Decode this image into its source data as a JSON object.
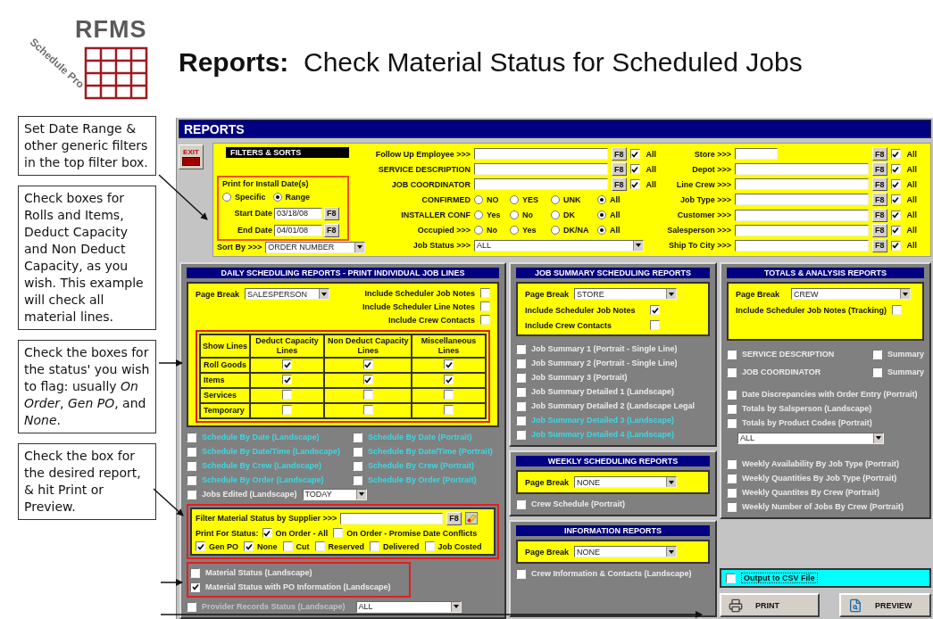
{
  "header": {
    "logo_name": "RFMS",
    "logo_tagline": "Schedule Pro",
    "title": "**Reports:**  Check Material Status for Scheduled Jobs"
  },
  "callouts": [
    {
      "text": "Set Date Range & other generic filters in the top filter box."
    },
    {
      "text": "Check boxes for Rolls and Items, Deduct Capacity and Non Deduct Capacity, as you wish.  This example will check all material lines."
    },
    {
      "text": "Check the boxes for the status' you wish to flag: usually *On Order*, *Gen PO*, and *None*."
    },
    {
      "text": "Check the box for the desired report, & hit Print or Preview."
    }
  ],
  "window": {
    "title": "REPORTS",
    "exit_label": "EXIT"
  },
  "filters": {
    "heading": "FILTERS & SORTS",
    "install_dates": {
      "title": "Print for Install Date(s)",
      "modes": [
        {
          "label": "Specific",
          "selected": false
        },
        {
          "label": "Range",
          "selected": true
        }
      ],
      "dates": [
        {
          "label": "Start Date",
          "value": "03/18/08",
          "button": "F8"
        },
        {
          "label": "End Date",
          "value": "04/01/08",
          "button": "F8"
        }
      ]
    },
    "sort": {
      "label": "Sort By >>>",
      "value": "ORDER NUMBER"
    },
    "left_filters": [
      {
        "kind": "text",
        "label": "Follow Up Employee >>>",
        "button": "F8",
        "all": {
          "label": "All",
          "checked": true
        }
      },
      {
        "kind": "text",
        "label": "SERVICE DESCRIPTION",
        "button": "F8",
        "all": {
          "label": "All",
          "checked": true
        }
      },
      {
        "kind": "text",
        "label": "JOB COORDINATOR",
        "button": "F8",
        "all": {
          "label": "All",
          "checked": true
        }
      },
      {
        "kind": "radio",
        "label": "CONFIRMED",
        "options": [
          {
            "label": "NO",
            "selected": false
          },
          {
            "label": "YES",
            "selected": false
          },
          {
            "label": "UNK",
            "selected": false
          },
          {
            "label": "All",
            "selected": true
          }
        ]
      },
      {
        "kind": "radio",
        "label": "INSTALLER CONF",
        "options": [
          {
            "label": "Yes",
            "selected": false
          },
          {
            "label": "No",
            "selected": false
          },
          {
            "label": "DK",
            "selected": false
          },
          {
            "label": "All",
            "selected": true
          }
        ]
      },
      {
        "kind": "radio",
        "label": "Occupied >>>",
        "options": [
          {
            "label": "No",
            "selected": false
          },
          {
            "label": "Yes",
            "selected": false
          },
          {
            "label": "DK/NA",
            "selected": false
          },
          {
            "label": "All",
            "selected": true
          }
        ]
      },
      {
        "kind": "select",
        "label": "Job Status >>>",
        "value": "ALL"
      }
    ],
    "right_filters": [
      {
        "label": "Store >>>",
        "short": true,
        "button": "F8",
        "all": {
          "label": "All",
          "checked": true
        }
      },
      {
        "label": "Depot >>>",
        "short": false,
        "button": "F8",
        "all": {
          "label": "All",
          "checked": true
        }
      },
      {
        "label": "Line Crew >>>",
        "short": false,
        "button": "F8",
        "all": {
          "label": "All",
          "checked": true
        }
      },
      {
        "label": "Job Type >>>",
        "short": false,
        "button": "F8",
        "all": {
          "label": "All",
          "checked": true
        }
      },
      {
        "label": "Customer >>>",
        "short": false,
        "button": "F8",
        "all": {
          "label": "All",
          "checked": true
        }
      },
      {
        "label": "Salesperson >>>",
        "short": false,
        "button": "F8",
        "all": {
          "label": "All",
          "checked": true
        }
      },
      {
        "label": "Ship To City >>>",
        "short": false,
        "button": "F8",
        "all": {
          "label": "All",
          "checked": true
        }
      }
    ]
  },
  "daily": {
    "title": "DAILY SCHEDULING REPORTS - PRINT INDIVIDUAL JOB LINES",
    "page_break": {
      "label": "Page Break",
      "value": "SALESPERSON"
    },
    "options": [
      {
        "label": "Include Scheduler Job Notes",
        "checked": false
      },
      {
        "label": "Include Scheduler Line Notes",
        "checked": false
      },
      {
        "label": "Include Crew Contacts",
        "checked": false
      }
    ],
    "lines": {
      "columns": [
        "Show Lines",
        "Deduct Capacity Lines",
        "Non Deduct Capacity Lines",
        "Miscellaneous Lines"
      ],
      "rows": [
        {
          "label": "Roll Goods",
          "checked": [
            true,
            true,
            true
          ]
        },
        {
          "label": "Items",
          "checked": [
            true,
            true,
            true
          ]
        },
        {
          "label": "Services",
          "checked": [
            false,
            false,
            false
          ]
        },
        {
          "label": "Temporary",
          "checked": [
            false,
            false,
            false
          ]
        }
      ]
    },
    "reports": [
      {
        "label": "Schedule By Date (Landscape)",
        "checked": false,
        "kind": "highlighted"
      },
      {
        "label": "Schedule By Date (Portrait)",
        "checked": false,
        "kind": "highlighted"
      },
      {
        "label": "Schedule By Date/Time (Landscape)",
        "checked": false,
        "kind": "highlighted"
      },
      {
        "label": "Schedule By Date/Time (Portrait)",
        "checked": false,
        "kind": "highlighted"
      },
      {
        "label": "Schedule By Crew (Landscape)",
        "checked": false,
        "kind": "highlighted"
      },
      {
        "label": "Schedule By Crew (Portrait)",
        "checked": false,
        "kind": "highlighted"
      },
      {
        "label": "Schedule By Order (Landscape)",
        "checked": false,
        "kind": "highlighted"
      },
      {
        "label": "Schedule By Order (Portrait)",
        "checked": false,
        "kind": "highlighted"
      }
    ],
    "jobs_edited": {
      "label": "Jobs Edited (Landscape)",
      "checked": false,
      "kind": "plain",
      "value": "TODAY"
    },
    "material_filter": {
      "label": "Filter Material Status by Supplier >>>",
      "button": "F8",
      "status_label": "Print For Status:",
      "status_rows": [
        [
          {
            "label": "On Order - All",
            "checked": true
          },
          {
            "label": "On Order - Promise Date Conflicts",
            "checked": false
          }
        ],
        [
          {
            "label": "Gen PO",
            "checked": true
          },
          {
            "label": "None",
            "checked": true
          },
          {
            "label": "Cut",
            "checked": false
          },
          {
            "label": "Reserved",
            "checked": false
          },
          {
            "label": "Delivered",
            "checked": false
          },
          {
            "label": "Job Costed",
            "checked": false
          }
        ]
      ]
    },
    "material_reports": [
      {
        "label": "Material Status (Landscape)",
        "checked": false,
        "kind": "plain"
      },
      {
        "label": "Material Status with PO Information (Landscape)",
        "checked": true,
        "kind": "plain"
      }
    ],
    "provider": {
      "label": "Provider Records Status (Landscape)",
      "checked": false,
      "kind": "disabled",
      "value": "ALL"
    }
  },
  "job_summary": {
    "title": "JOB SUMMARY SCHEDULING REPORTS",
    "page_break": {
      "label": "Page Break",
      "value": "STORE"
    },
    "options": [
      {
        "label": "Include Scheduler Job Notes",
        "checked": true
      },
      {
        "label": "Include Crew Contacts",
        "checked": false
      }
    ],
    "reports": [
      {
        "label": "Job Summary 1 (Portrait - Single Line)",
        "checked": false,
        "kind": "plain"
      },
      {
        "label": "Job Summary 2 (Portrait - Single Line)",
        "checked": false,
        "kind": "plain"
      },
      {
        "label": "Job Summary 3 (Portrait)",
        "checked": false,
        "kind": "plain"
      },
      {
        "label": "Job Summary Detailed 1 (Landscape)",
        "checked": false,
        "kind": "plain"
      },
      {
        "label": "Job Summary Detailed 2 (Landscape Legal",
        "checked": false,
        "kind": "plain"
      },
      {
        "label": "Job Summary Detailed 3 (Landscape)",
        "checked": false,
        "kind": "highlighted"
      },
      {
        "label": "Job Summary Detailed 4 (Landscape)",
        "checked": false,
        "kind": "highlighted"
      }
    ]
  },
  "weekly": {
    "title": "WEEKLY SCHEDULING REPORTS",
    "page_break": {
      "label": "Page Break",
      "value": "NONE"
    },
    "reports": [
      {
        "label": "Crew Schedule (Portrait)",
        "checked": false,
        "kind": "plain"
      }
    ]
  },
  "information": {
    "title": "INFORMATION REPORTS",
    "page_break": {
      "label": "Page Break",
      "value": "NONE"
    },
    "reports": [
      {
        "label": "Crew Information & Contacts (Landscape)",
        "checked": false,
        "kind": "plain"
      }
    ]
  },
  "totals": {
    "title": "TOTALS & ANALYSIS REPORTS",
    "page_break": {
      "label": "Page Break",
      "value": "CREW"
    },
    "options": [
      {
        "label": "Include Scheduler Job Notes (Tracking)",
        "checked": false
      }
    ],
    "pairs": [
      {
        "label": "SERVICE DESCRIPTION",
        "checked": false,
        "summary": {
          "label": "Summary",
          "checked": false
        }
      },
      {
        "label": "JOB COORDINATOR",
        "checked": false,
        "summary": {
          "label": "Summary",
          "checked": false
        }
      }
    ],
    "reports": [
      {
        "label": "Date Discrepancies with Order Entry (Portrait)",
        "checked": false,
        "kind": "plain"
      },
      {
        "label": "Totals by Salsperson (Landscape)",
        "checked": false,
        "kind": "plain"
      },
      {
        "label": "Totals by Product Codes (Portrait)",
        "checked": false,
        "kind": "plain"
      }
    ],
    "product_codes": {
      "value": "ALL"
    },
    "weekly_reports": [
      {
        "label": "Weekly Availability By Job Type (Portrait)",
        "checked": false,
        "kind": "plain"
      },
      {
        "label": "Weekly Quantities By Job Type (Portrait)",
        "checked": false,
        "kind": "plain"
      },
      {
        "label": "Weekly Quantites By Crew (Portrait)",
        "checked": false,
        "kind": "plain"
      },
      {
        "label": "Weekly Number of Jobs By Crew (Portrait)",
        "checked": false,
        "kind": "plain"
      }
    ]
  },
  "csv": {
    "label": "Output to CSV File",
    "checked": false
  },
  "actions": [
    {
      "kind": "print",
      "label": "PRINT"
    },
    {
      "kind": "preview",
      "label": "PREVIEW"
    }
  ]
}
